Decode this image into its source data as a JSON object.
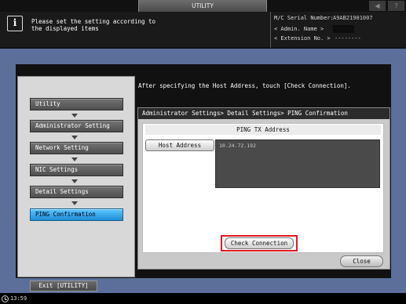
{
  "header": {
    "title": "UTILITY",
    "message": "Please set the setting according to\nthe displayed items",
    "serial_label": "M/C Serial Number:",
    "serial_value": "A9AB21901007",
    "admin_label": "< Admin. Name >",
    "extension_label": "< Extension No. >",
    "extension_value": "--------",
    "icons": [
      "info-icon",
      "speaker-icon",
      "help-icon"
    ]
  },
  "instruction": "After specifying the Host Address, touch [Check Connection].",
  "nav": {
    "items": [
      {
        "label": "Utility",
        "active": false
      },
      {
        "label": "Administrator Setting",
        "active": false
      },
      {
        "label": "Network Setting",
        "active": false
      },
      {
        "label": "NIC Settings",
        "active": false
      },
      {
        "label": "Detail Settings",
        "active": false
      },
      {
        "label": "PING Confirmation",
        "active": true
      }
    ]
  },
  "dialog": {
    "breadcrumb": "Administrator Settings> Detail Settings> PING Confirmation",
    "section_title": "PING TX Address",
    "host_address_label": "Host Address",
    "host_address_value": "10.24.72.192",
    "check_connection_label": "Check Connection",
    "close_label": "Close"
  },
  "footer": {
    "exit_label": "Exit [UTILITY]",
    "time": "13:59"
  },
  "colors": {
    "frame_blue": "#5c6f9a",
    "active_item": "#2a9be0",
    "highlight_red": "#e0191f"
  }
}
